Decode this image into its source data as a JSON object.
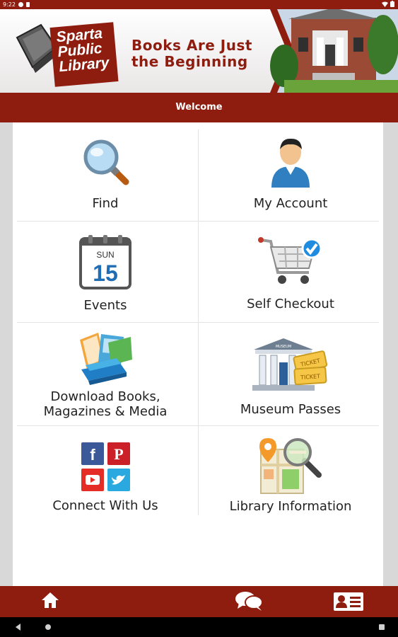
{
  "status_bar": {
    "time": "9:22"
  },
  "banner": {
    "logo_lines": [
      "Sparta",
      "Public",
      "Library"
    ],
    "tagline_lines": [
      "Books Are Just",
      "the Beginning"
    ]
  },
  "header": {
    "title": "Welcome"
  },
  "tiles": [
    {
      "label": "Find",
      "icon": "magnifier-icon"
    },
    {
      "label": "My Account",
      "icon": "user-icon"
    },
    {
      "label": "Events",
      "icon": "calendar-icon",
      "calendar_day": "SUN",
      "calendar_date": "15"
    },
    {
      "label": "Self Checkout",
      "icon": "cart-check-icon"
    },
    {
      "label_lines": [
        "Download Books,",
        "Magazines & Media"
      ],
      "icon": "books-icon"
    },
    {
      "label": "Museum Passes",
      "icon": "museum-tickets-icon",
      "museum_text": "MUSEUM",
      "ticket_text": "TICKET"
    },
    {
      "label": "Connect With Us",
      "icon": "social-icons"
    },
    {
      "label": "Library Information",
      "icon": "map-search-icon"
    }
  ],
  "bottom_nav": [
    "home-icon",
    "chat-icon",
    "contact-card-icon"
  ],
  "colors": {
    "brand": "#8f1d0f",
    "content_bg": "#d8d8d8",
    "card": "#ffffff"
  }
}
